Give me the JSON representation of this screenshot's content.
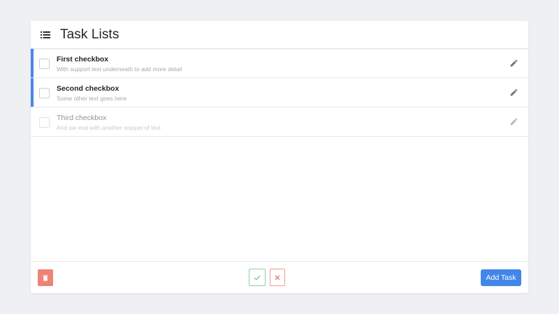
{
  "header": {
    "title": "Task Lists",
    "icon": "list-icon"
  },
  "tasks": [
    {
      "title": "First checkbox",
      "subtitle": "With support text underneath to add more detail",
      "checked": false,
      "enabled": true,
      "active": true
    },
    {
      "title": "Second checkbox",
      "subtitle": "Some other text goes here",
      "checked": false,
      "enabled": true,
      "active": true
    },
    {
      "title": "Third checkbox",
      "subtitle": "And we end with another snippet of text",
      "checked": false,
      "enabled": false,
      "active": false
    }
  ],
  "footer": {
    "add_label": "Add Task"
  },
  "colors": {
    "accent": "#4a86e8",
    "delete": "#ef8276",
    "confirm": "#8cd29c",
    "cancel": "#ef9a90",
    "primary": "#4286ea"
  }
}
